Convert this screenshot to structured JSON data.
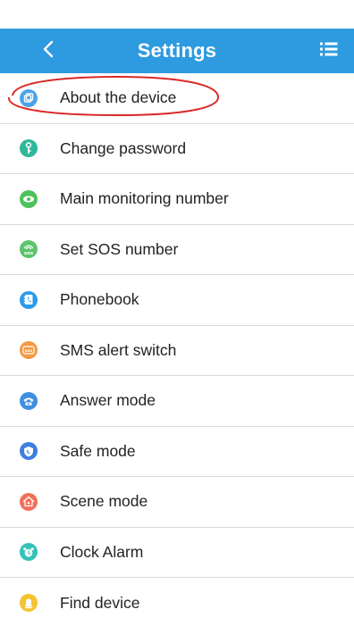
{
  "header": {
    "title": "Settings",
    "back_icon": "chevron-left-icon",
    "menu_icon": "list-icon",
    "background": "#2e9ae0"
  },
  "items": [
    {
      "label": "About the device",
      "icon": "device-icon",
      "color": "#4aa3ea"
    },
    {
      "label": "Change password",
      "icon": "key-icon",
      "color": "#2fb89a"
    },
    {
      "label": "Main monitoring number",
      "icon": "eye-icon",
      "color": "#4cc25c"
    },
    {
      "label": "Set SOS number",
      "icon": "sos-icon",
      "color": "#5cc46a"
    },
    {
      "label": "Phonebook",
      "icon": "phonebook-icon",
      "color": "#2a9be8"
    },
    {
      "label": "SMS alert switch",
      "icon": "sms-sos-icon",
      "color": "#f39a45"
    },
    {
      "label": "Answer mode",
      "icon": "phone-answer-icon",
      "color": "#3f8fe0"
    },
    {
      "label": "Safe mode",
      "icon": "shield-icon",
      "color": "#3b7fe0"
    },
    {
      "label": "Scene mode",
      "icon": "house-icon",
      "color": "#f0705a"
    },
    {
      "label": "Clock Alarm",
      "icon": "alarm-clock-icon",
      "color": "#34c2b8"
    },
    {
      "label": "Find device",
      "icon": "bell-icon",
      "color": "#f5c230"
    }
  ],
  "annotation": {
    "type": "highlight-ellipse",
    "color": "#d92a2a"
  }
}
